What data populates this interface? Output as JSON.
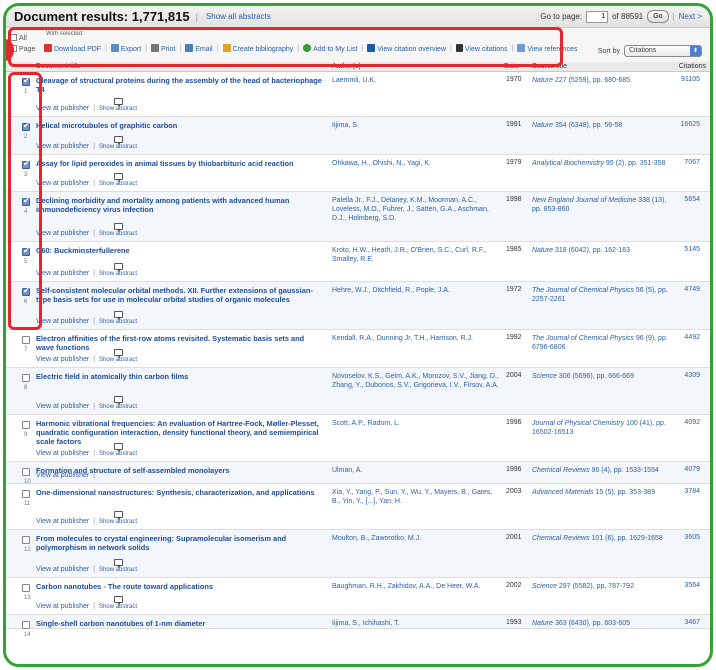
{
  "header": {
    "title": "Document results: 1,771,815",
    "show_all": "Show all abstracts",
    "goto_label": "Go to page:",
    "goto_value": "1",
    "of_pages": "of 88591",
    "go": "Go",
    "next": "Next >"
  },
  "toolbar": {
    "all": "All",
    "page": "Page",
    "with_selected": "With selected:",
    "actions": [
      {
        "label": "Download PDF",
        "icon": "pdf-icon"
      },
      {
        "label": "Export",
        "icon": "export-icon"
      },
      {
        "label": "Print",
        "icon": "print-icon"
      },
      {
        "label": "Email",
        "icon": "email-icon"
      },
      {
        "label": "Create bibliography",
        "icon": "bibliography-icon"
      },
      {
        "label": "Add to My List",
        "icon": "add-icon"
      },
      {
        "label": "View citation overview",
        "icon": "citation-overview-icon"
      },
      {
        "label": "View citations",
        "icon": "quote-icon"
      },
      {
        "label": "View references",
        "icon": "references-icon"
      }
    ],
    "sort_label": "Sort by",
    "sort_value": "Citations"
  },
  "columns": {
    "title": "Document title",
    "authors": "Author(s)",
    "date": "Date",
    "source": "Source title",
    "citations": "Citations"
  },
  "links": {
    "publisher": "View at publisher",
    "abstract": "Show abstract"
  },
  "rows": [
    {
      "num": "1",
      "checked": true,
      "title": "Cleavage of structural proteins during the assembly of the head of bacteriophage T4",
      "authors": "Laemmli, U.K.",
      "date": "1970",
      "source_journal": "Nature",
      "source_rest": " 227 (5259), pp. 680-685",
      "citations": "91105"
    },
    {
      "num": "2",
      "checked": true,
      "title": "Helical microtubules of graphitic carbon",
      "authors": "Iijima, S.",
      "date": "1991",
      "source_journal": "Nature",
      "source_rest": " 354 (6348), pp. 56-58",
      "citations": "16625"
    },
    {
      "num": "3",
      "checked": true,
      "title": "Assay for lipid peroxides in animal tissues by thiobarbituric acid reaction",
      "authors": "Ohkawa, H., Ohishi, N., Yagi, K.",
      "date": "1979",
      "source_journal": "Analytical Biochemistry",
      "source_rest": " 95 (2), pp. 351-358",
      "citations": "7067"
    },
    {
      "num": "4",
      "checked": true,
      "title": "Declining morbidity and mortality among patients with advanced human immunodeficiency virus infection",
      "authors": "Palella Jr., F.J., Delaney, K.M., Moorman, A.C., Loveless, M.O., Fuhrer, J., Satten, G.A., Aschman, D.J., Holmberg, S.D.",
      "date": "1998",
      "source_journal": "New England Journal of Medicine",
      "source_rest": " 338 (13), pp. 853-860",
      "citations": "5654"
    },
    {
      "num": "5",
      "checked": true,
      "title": "C60: Buckminsterfullerene",
      "authors": "Kroto, H.W., Heath, J.R., O'Brien, S.C., Curl, R.F., Smalley, R.E.",
      "date": "1985",
      "source_journal": "Nature",
      "source_rest": " 318 (6042), pp. 162-163",
      "citations": "5145"
    },
    {
      "num": "6",
      "checked": true,
      "title": "Self-consistent molecular orbital methods. XII. Further extensions of gaussian-type basis sets for use in molecular orbital studies of organic molecules",
      "authors": "Hehre, W.J., Ditchfield, R., Pople, J.A.",
      "date": "1972",
      "source_journal": "The Journal of Chemical Physics",
      "source_rest": " 56 (5), pp. 2257-2261",
      "citations": "4749"
    },
    {
      "num": "7",
      "checked": false,
      "title": "Electron affinities of the first-row atoms revisited. Systematic basis sets and wave functions",
      "authors": "Kendall, R.A., Dunning Jr, T.H., Harrison, R.J.",
      "date": "1992",
      "source_journal": "The Journal of Chemical Physics",
      "source_rest": " 96 (9), pp. 6796-6806",
      "citations": "4492"
    },
    {
      "num": "8",
      "checked": false,
      "title": "Electric field in atomically thin carbon films",
      "authors": "Novoselov, K.S., Geim, A.K., Morozov, S.V., Jiang, D., Zhang, Y., Dubonos, S.V., Grigorieva, I.V., Firsov, A.A.",
      "date": "2004",
      "source_journal": "Science",
      "source_rest": " 306 (5696), pp. 666-669",
      "citations": "4309"
    },
    {
      "num": "9",
      "checked": false,
      "title": "Harmonic vibrational frequencies: An evaluation of Hartree-Fock, Møller-Plesset, quadratic configuration interaction, density functional theory, and semiempirical scale factors",
      "authors": "Scott, A.P., Radom, L.",
      "date": "1996",
      "source_journal": "Journal of Physical Chemistry",
      "source_rest": " 100 (41), pp. 16502-16513",
      "citations": "4092"
    },
    {
      "num": "10",
      "checked": false,
      "title": "Formation and structure of self-assembled monolayers",
      "authors": "Ulman, A.",
      "date": "1996",
      "source_journal": "Chemical Reviews",
      "source_rest": " 96 (4), pp. 1533-1554",
      "citations": "4079"
    },
    {
      "num": "11",
      "checked": false,
      "title": "One-dimensional nanostructures: Synthesis, characterization, and applications",
      "authors": "Xia, Y., Yang, P., Sun, Y., Wu, Y., Mayers, B., Gates, B., Yin, Y., [...], Yan, H.",
      "date": "2003",
      "source_journal": "Advanced Materials",
      "source_rest": " 15 (5), pp. 353-389",
      "citations": "3784"
    },
    {
      "num": "12",
      "checked": false,
      "title": "From molecules to crystal engineering: Supramolecular isomerism and polymorphism in network solids",
      "authors": "Moulton, B., Zaworotko, M.J.",
      "date": "2001",
      "source_journal": "Chemical Reviews",
      "source_rest": " 101 (6), pp. 1629-1658",
      "citations": "3605"
    },
    {
      "num": "13",
      "checked": false,
      "title": "Carbon nanotubes - The route toward applications",
      "authors": "Baughman, R.H., Zakhidov, A.A., De Heer, W.A.",
      "date": "2002",
      "source_journal": "Science",
      "source_rest": " 297 (5582), pp. 787-792",
      "citations": "3564"
    },
    {
      "num": "14",
      "checked": false,
      "title": "Single-shell carbon nanotubes of 1-nm diameter",
      "authors": "Iijima, S., Ichihashi, T.",
      "date": "1993",
      "source_journal": "Nature",
      "source_rest": " 363 (6430), pp. 603-605",
      "citations": "3467"
    }
  ],
  "colors": {
    "frame": "#33a336",
    "highlight": "#e4262f",
    "link": "#2d5fa8"
  }
}
